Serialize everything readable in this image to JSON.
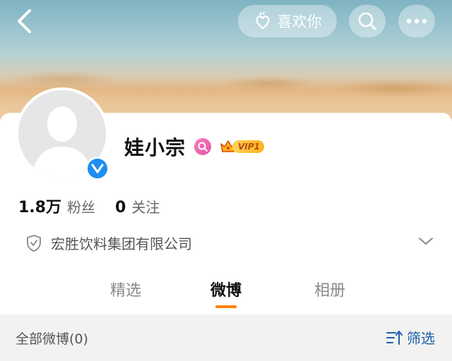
{
  "header": {
    "back_icon": "chevron-left-icon",
    "like_label": "喜欢你",
    "like_icon": "hand-heart-icon",
    "search_icon": "search-icon",
    "more_icon": "more-dots-icon"
  },
  "profile": {
    "name": "娃小宗",
    "verified": true,
    "vip_label": "VIP1",
    "followers_count": "1.8万",
    "followers_label": "粉丝",
    "following_count": "0",
    "following_label": "关注",
    "company": "宏胜饮料集团有限公司"
  },
  "tabs": [
    {
      "label": "精选",
      "active": false
    },
    {
      "label": "微博",
      "active": true
    },
    {
      "label": "相册",
      "active": false
    }
  ],
  "feed": {
    "all_label": "全部微博(0)",
    "filter_label": "筛选"
  },
  "colors": {
    "accent": "#ff8200",
    "verify_blue": "#1d8ff0",
    "link_blue": "#1b5fa8"
  }
}
